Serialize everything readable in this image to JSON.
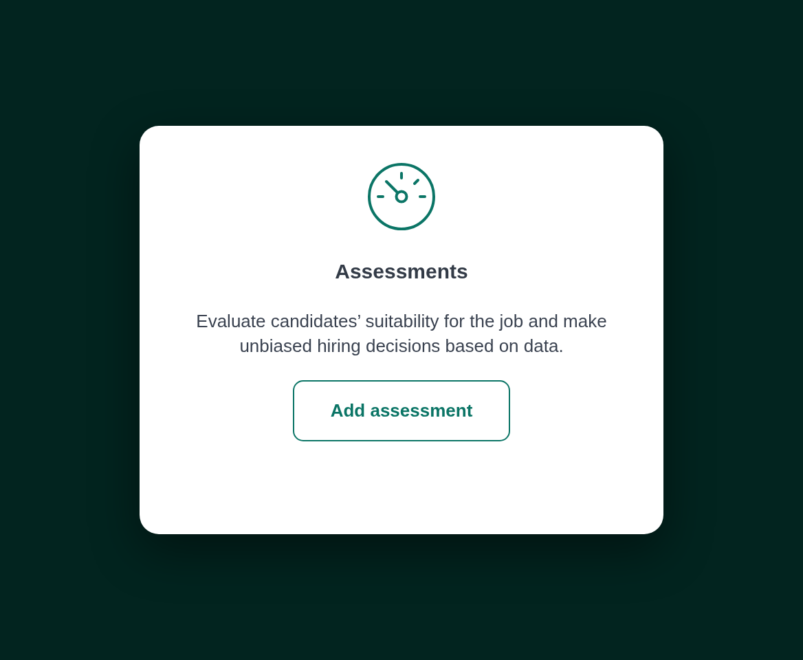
{
  "card": {
    "title": "Assessments",
    "description": "Evaluate candidates’ suitability for the job and make unbiased hiring decisions based on data.",
    "button": {
      "label": "Add assessment"
    }
  }
}
